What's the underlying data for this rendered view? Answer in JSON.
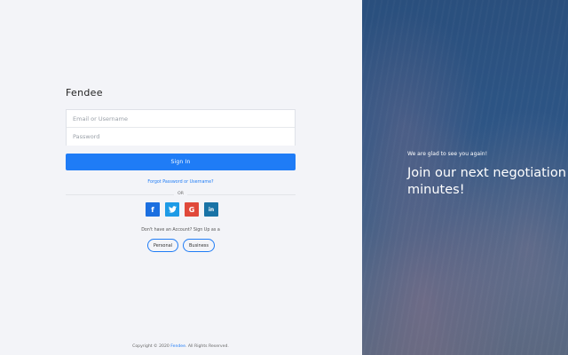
{
  "brand": {
    "name": "Fendee"
  },
  "login": {
    "username_placeholder": "Email or Username",
    "password_placeholder": "Password",
    "signin_label": "Sign In",
    "forgot_link": "Forgot Password or Username?",
    "or_label": "OR"
  },
  "social": {
    "facebook": "f",
    "twitter": "t",
    "google": "G",
    "linkedin": "in"
  },
  "signup": {
    "prompt": "Don't have an Account? Sign Up as a",
    "personal_label": "Personal",
    "business_label": "Business"
  },
  "footer": {
    "prefix": "Copyright © 2020 ",
    "link": "Fendee",
    "suffix": ". All Rights Reserved."
  },
  "hero": {
    "welcome": "We are glad to see you again!",
    "headline_line1": "Join our next negotiation",
    "headline_line2": "minutes!"
  },
  "colors": {
    "accent": "#1f7cf6",
    "facebook": "#1b6fe0",
    "twitter": "#1e9be6",
    "google": "#e0493a",
    "linkedin": "#1973a6"
  }
}
